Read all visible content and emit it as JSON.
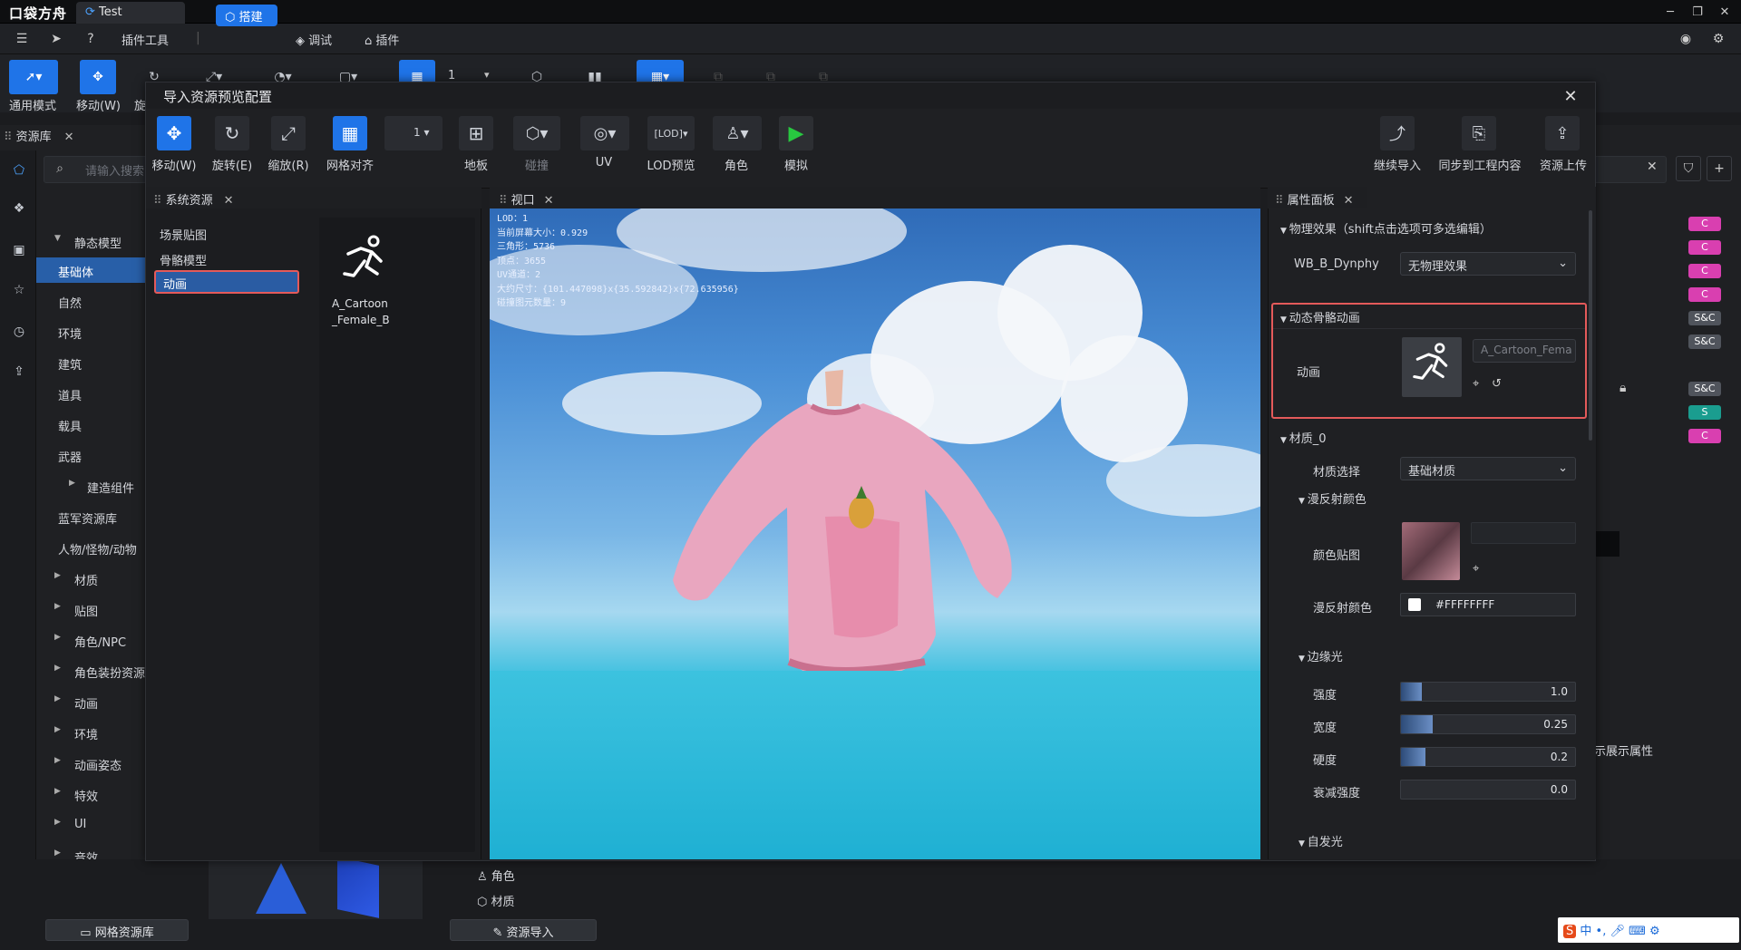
{
  "app": {
    "logo": "口袋方舟",
    "tab_title": "Test"
  },
  "menu": {
    "plugin_tools": "插件工具",
    "build": "搭建",
    "debug": "调试",
    "plugin": "插件"
  },
  "main_toolbar": {
    "general_mode": "通用模式",
    "move": "移动(W)",
    "rotate_partial": "旋",
    "lod_value": "1"
  },
  "assets": {
    "tab": "资源库",
    "search_placeholder": "请输入搜索",
    "categories": [
      {
        "label": "静态模型",
        "expanded": true
      },
      {
        "label": "基础体",
        "selected": true
      },
      {
        "label": "自然"
      },
      {
        "label": "环境"
      },
      {
        "label": "建筑"
      },
      {
        "label": "道具"
      },
      {
        "label": "载具"
      },
      {
        "label": "武器"
      },
      {
        "label": "建造组件",
        "collapsed": true
      },
      {
        "label": "蓝军资源库"
      },
      {
        "label": "人物/怪物/动物"
      },
      {
        "label": "材质",
        "collapsed": true
      },
      {
        "label": "贴图",
        "collapsed": true
      },
      {
        "label": "角色/NPC",
        "collapsed": true
      },
      {
        "label": "角色装扮资源",
        "collapsed": true
      },
      {
        "label": "动画",
        "collapsed": true
      },
      {
        "label": "环境",
        "collapsed": true
      },
      {
        "label": "动画姿态",
        "collapsed": true
      },
      {
        "label": "特效",
        "collapsed": true
      },
      {
        "label": "UI",
        "collapsed": true
      },
      {
        "label": "音效",
        "collapsed": true
      }
    ],
    "network_assets_button": "网格资源库",
    "badges": [
      "C",
      "C",
      "C",
      "C",
      "S&C",
      "S&C",
      "S&C",
      "S",
      "C"
    ],
    "show_props_partial": "示展示属性",
    "bottom_items": {
      "role": "角色",
      "material": "材质",
      "import_button": "资源导入"
    }
  },
  "dialog": {
    "title": "导入资源预览配置",
    "toolbar": {
      "move": "移动(W)",
      "rotate": "旋转(E)",
      "scale": "缩放(R)",
      "grid_align": "网格对齐",
      "grid_value": "1",
      "floor": "地板",
      "collision": "碰撞",
      "uv": "UV",
      "lod": "LOD预览",
      "role": "角色",
      "simulate": "模拟",
      "continue_import": "继续导入",
      "sync_project": "同步到工程内容",
      "upload": "资源上传"
    },
    "system_assets": {
      "tab": "系统资源",
      "items": [
        "场景贴图",
        "骨骼模型",
        "动画"
      ],
      "selected": "动画",
      "asset_card": "A_Cartoon\n_Female_B"
    },
    "viewport": {
      "tab": "视口",
      "info": [
        "LOD：1",
        "当前屏幕大小：0.929",
        "三角形：5736",
        "顶点：3655",
        "UV通道：2",
        "大约尺寸：{101.447098}x{35.592842}x{72.635956}",
        "碰撞图元数量：9"
      ]
    },
    "properties": {
      "tab": "属性面板",
      "physics_section": "物理效果（shift点击选项可多选编辑）",
      "physics_name": "WB_B_Dynphy",
      "physics_value": "无物理效果",
      "anim_section": "动态骨骼动画",
      "anim_label": "动画",
      "anim_value": "A_Cartoon_Fema",
      "material_section": "材质_0",
      "material_select_label": "材质选择",
      "material_select_value": "基础材质",
      "diffuse_section": "漫反射颜色",
      "color_map_label": "颜色贴图",
      "diffuse_color_label": "漫反射颜色",
      "diffuse_color_value": "#FFFFFFFF",
      "rim_section": "边缘光",
      "sliders": [
        {
          "label": "强度",
          "value": "1.0",
          "fill": 0.12
        },
        {
          "label": "宽度",
          "value": "0.25",
          "fill": 0.18
        },
        {
          "label": "硬度",
          "value": "0.2",
          "fill": 0.14
        },
        {
          "label": "衰减强度",
          "value": "0.0",
          "fill": 0
        }
      ],
      "emissive_section": "自发光"
    }
  },
  "colors": {
    "accent": "#1f74e8",
    "highlight_border": "#e45a5a",
    "selected": "#2a5ca3",
    "badge_pink": "#d93fb0",
    "badge_teal": "#1a9d8f"
  }
}
